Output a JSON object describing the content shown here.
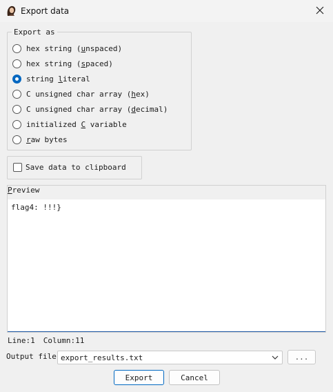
{
  "window": {
    "title": "Export data"
  },
  "export_as": {
    "title": "Export as",
    "selected_index": 2,
    "options": [
      {
        "pre": "hex string (",
        "key": "u",
        "post": "nspaced)"
      },
      {
        "pre": "hex string (",
        "key": "s",
        "post": "paced)"
      },
      {
        "pre": "string ",
        "key": "l",
        "post": "iteral"
      },
      {
        "pre": "C unsigned char array (",
        "key": "h",
        "post": "ex)"
      },
      {
        "pre": "C unsigned char array (",
        "key": "d",
        "post": "ecimal)"
      },
      {
        "pre": "initialized ",
        "key": "C",
        "post": " variable"
      },
      {
        "pre": "",
        "key": "r",
        "post": "aw bytes"
      }
    ]
  },
  "clipboard": {
    "label": "Save data to clipboard",
    "checked": false
  },
  "preview": {
    "label_key": "P",
    "label_rest": "review",
    "content": "flag4: !!!}"
  },
  "status": {
    "line": "Line:1",
    "column": "Column:11"
  },
  "output": {
    "label": "Output file",
    "value": "export_results.txt",
    "browse_label": "..."
  },
  "buttons": {
    "export": "Export",
    "cancel": "Cancel"
  },
  "colors": {
    "accent": "#0067c0",
    "focus_border": "#1f5aa6"
  },
  "icons": {
    "app": "avatar-icon",
    "close": "close-icon",
    "dropdown": "chevron-down-icon"
  }
}
